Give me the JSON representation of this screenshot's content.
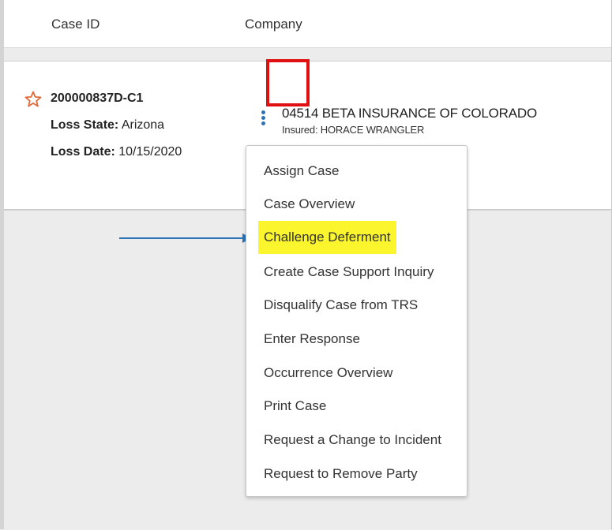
{
  "columns": {
    "case_id": "Case ID",
    "company": "Company"
  },
  "case": {
    "id": "200000837D-C1",
    "loss_state_label": "Loss State:",
    "loss_state": "Arizona",
    "loss_date_label": "Loss Date:",
    "loss_date": "10/15/2020"
  },
  "company": {
    "name": "04514 BETA INSURANCE OF COLORADO",
    "insured": "Insured: HORACE WRANGLER"
  },
  "menu": {
    "items": [
      "Assign Case",
      "Case Overview",
      "Challenge Deferment",
      "Create Case Support Inquiry",
      "Disqualify Case from TRS",
      "Enter Response",
      "Occurrence Overview",
      "Print Case",
      "Request a Change to Incident",
      "Request to Remove Party"
    ],
    "highlighted": "Challenge Deferment"
  },
  "colors": {
    "accent": "#2b73b5",
    "highlight": "#fbf52e",
    "annotation_box": "#e01010",
    "star": "#e06a3a"
  },
  "icons": {
    "favorite": "star-outline-icon",
    "actions": "kebab-menu-icon",
    "pointer": "arrow-right-icon"
  }
}
